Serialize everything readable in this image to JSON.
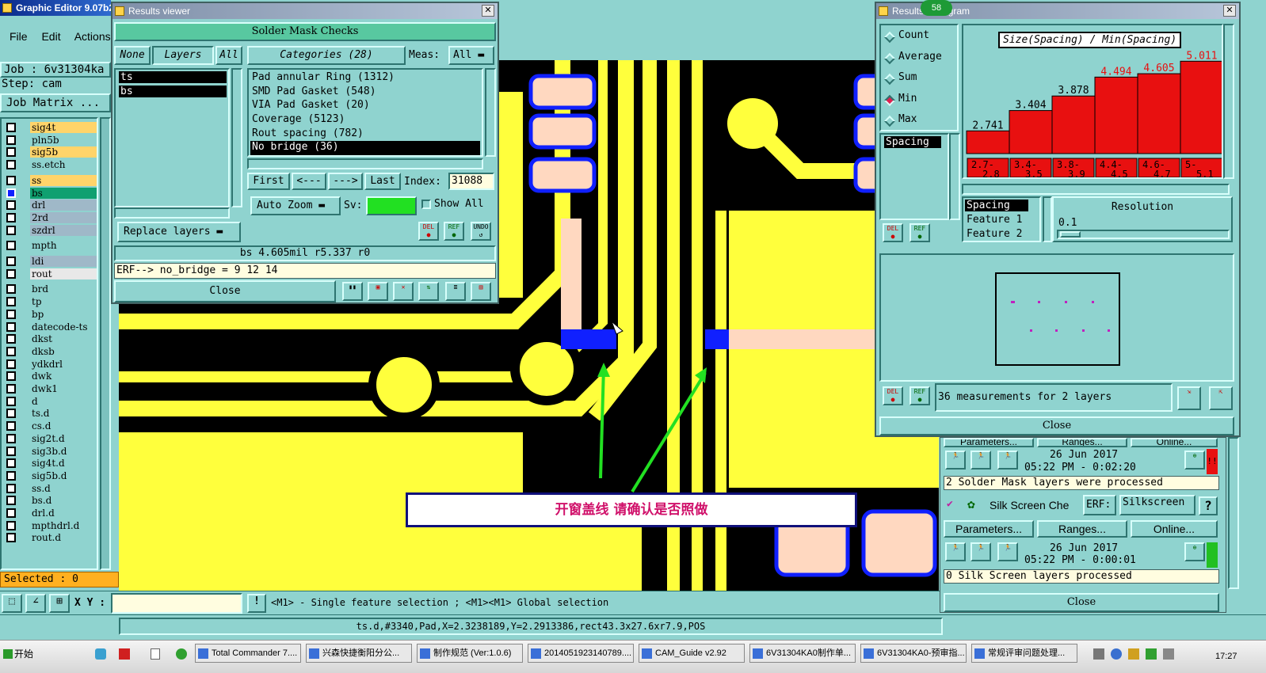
{
  "main_window": {
    "title": "Graphic Editor 9.07b2"
  },
  "menu": [
    "File",
    "Edit",
    "Actions"
  ],
  "job": {
    "job_label": "Job : 6v31304ka",
    "step_label": "Step: cam",
    "matrix_button": "Job Matrix ..."
  },
  "layers": [
    {
      "name": "sig4t",
      "color": "#ffd46a"
    },
    {
      "name": "pln5b",
      "color": "#8fd3cf"
    },
    {
      "name": "sig5b",
      "color": "#ffd46a"
    },
    {
      "name": "ss.etch",
      "color": "#8fd3cf"
    },
    {
      "name": "ss",
      "color": "#ffd46a"
    },
    {
      "name": "bs",
      "color": "#10a070"
    },
    {
      "name": "drl",
      "color": "#9fb8c8"
    },
    {
      "name": "2rd",
      "color": "#9fb8c8"
    },
    {
      "name": "szdrl",
      "color": "#9fb8c8"
    },
    {
      "name": "mpth",
      "color": "#8fd3cf"
    },
    {
      "name": "ldi",
      "color": "#9fb8c8"
    },
    {
      "name": "rout",
      "color": "#e8e8e8"
    },
    {
      "name": "brd",
      "color": "#8fd3cf"
    },
    {
      "name": "tp",
      "color": "#8fd3cf"
    },
    {
      "name": "bp",
      "color": "#8fd3cf"
    },
    {
      "name": "datecode-ts",
      "color": "#8fd3cf"
    },
    {
      "name": "dkst",
      "color": "#8fd3cf"
    },
    {
      "name": "dksb",
      "color": "#8fd3cf"
    },
    {
      "name": "ydkdrl",
      "color": "#8fd3cf"
    },
    {
      "name": "dwk",
      "color": "#8fd3cf"
    },
    {
      "name": "dwk1",
      "color": "#8fd3cf"
    },
    {
      "name": "d",
      "color": "#8fd3cf"
    },
    {
      "name": "ts.d",
      "color": "#8fd3cf"
    },
    {
      "name": "cs.d",
      "color": "#8fd3cf"
    },
    {
      "name": "sig2t.d",
      "color": "#8fd3cf"
    },
    {
      "name": "sig3b.d",
      "color": "#8fd3cf"
    },
    {
      "name": "sig4t.d",
      "color": "#8fd3cf"
    },
    {
      "name": "sig5b.d",
      "color": "#8fd3cf"
    },
    {
      "name": "ss.d",
      "color": "#8fd3cf"
    },
    {
      "name": "bs.d",
      "color": "#8fd3cf"
    },
    {
      "name": "drl.d",
      "color": "#8fd3cf"
    },
    {
      "name": "mpthdrl.d",
      "color": "#8fd3cf"
    },
    {
      "name": "rout.d",
      "color": "#8fd3cf"
    }
  ],
  "selected_label": "Selected : 0",
  "bottom_bar": {
    "xy_label": "X Y :",
    "xy_value": "",
    "hint": "<M1> - Single feature selection ; <M1><M1> Global selection"
  },
  "status_line": "ts.d,#3340,Pad,X=2.3238189,Y=2.2913386,rect43.3x27.6xr7.9,POS",
  "results_viewer": {
    "title": "Results viewer",
    "check_name": "Solder Mask Checks",
    "tabs": [
      "None",
      "Layers",
      "All"
    ],
    "layers": [
      "ts",
      "bs"
    ],
    "categories_label": "Categories (28)",
    "meas_label": "Meas:",
    "meas_value": "All",
    "categories": [
      "Pad annular Ring (1312)",
      "SMD Pad Gasket (548)",
      "VIA Pad Gasket (20)",
      "Coverage (5123)",
      "Rout spacing (782)",
      "No bridge (36)"
    ],
    "nav": {
      "first": "First",
      "prev": "<---",
      "next": "--->",
      "last": "Last",
      "index_label": "Index:",
      "index_value": "31088"
    },
    "zoom_label": "Auto Zoom",
    "sv_label": "Sv:",
    "sv_color": "#22e022",
    "show_all_label": "Show All",
    "replace_label": "Replace layers",
    "icon_labels": [
      "DEL",
      "REF",
      "UNDO"
    ],
    "info": "bs 4.605mil   r5.337   r0",
    "erf_line": "ERF--> no_bridge = 9 12 14",
    "close_label": "Close"
  },
  "histogram": {
    "title": "Results Histogram",
    "badge": "58",
    "modes": [
      "Count",
      "Average",
      "Sum",
      "Min",
      "Max"
    ],
    "selected_mode": "Min",
    "attr_list": [
      "Spacing"
    ],
    "chart_title": "Size(Spacing) / Min(Spacing)",
    "resolution_label": "Resolution",
    "resolution_value": "0.1",
    "features": [
      "Spacing",
      "Feature 1",
      "Feature 2"
    ],
    "icon_labels": [
      "DEL",
      "REF"
    ],
    "measurements_label": "36 measurements for 2 layers",
    "close_label": "Close"
  },
  "chart_data": {
    "type": "bar",
    "title": "Size(Spacing) / Min(Spacing)",
    "categories": [
      "2.7-2.8",
      "3.4-3.5",
      "3.8-3.9",
      "4.4-4.5",
      "4.6-4.7",
      "5-5.1"
    ],
    "values": [
      2.741,
      3.404,
      3.878,
      4.494,
      4.605,
      5.011
    ],
    "value_labels": [
      "2.741",
      "3.404",
      "3.878",
      "4.494",
      "4.605",
      "5.011"
    ],
    "label_colors": [
      "#000000",
      "#000000",
      "#000000",
      "#e81010",
      "#e81010",
      "#e81010"
    ],
    "bar_color": "#e81010",
    "ylim": [
      2,
      5.2
    ]
  },
  "checklist": {
    "row1_labels": [
      "Parameters...",
      "Ranges...",
      "Online..."
    ],
    "sm_date": "26 Jun 2017",
    "sm_time": "05:22 PM - 0:02:20",
    "sm_status": "2 Solder Mask layers were processed",
    "sm_flag_color": "#e81010",
    "silk_name": "Silk Screen Che",
    "erf_label": "ERF:",
    "erf_value": "Silkscreen",
    "help_label": "?",
    "row2_labels": [
      "Parameters...",
      "Ranges...",
      "Online..."
    ],
    "ss_date": "26 Jun 2017",
    "ss_time": "05:22 PM - 0:00:01",
    "ss_status": "0 Silk Screen layers processed",
    "ss_flag_color": "#22c022",
    "close_label": "Close"
  },
  "annotation": {
    "text": "开窗盖线  请确认是否照做",
    "color": "#d0106a"
  },
  "taskbar": {
    "start": "开始",
    "items": [
      "Total Commander 7....",
      "兴森快捷衡阳分公...",
      "制作规范 (Ver:1.0.6)",
      "2014051923140789....",
      "CAM_Guide v2.92",
      "6V31304KA0制作单...",
      "6V31304KA0-预审指...",
      "常规评审问题处理..."
    ],
    "clock": "17:27"
  }
}
